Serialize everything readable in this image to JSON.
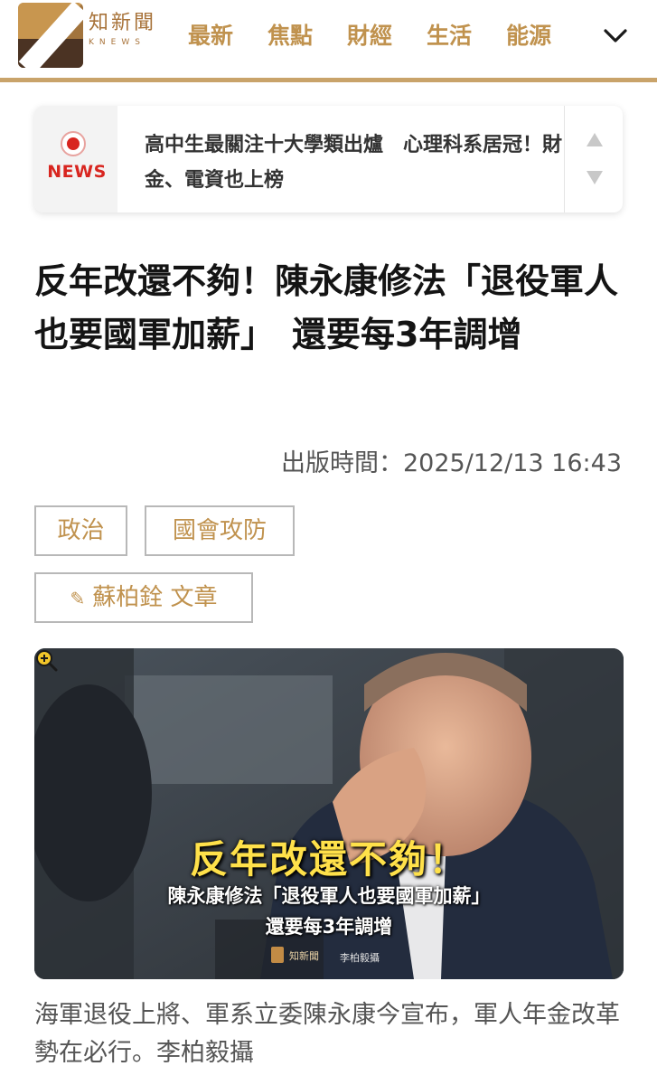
{
  "header": {
    "logo_cn": "知新聞",
    "logo_en": "KNEWS",
    "nav": [
      "最新",
      "焦點",
      "財經",
      "生活",
      "能源"
    ]
  },
  "ticker": {
    "badge": "NEWS",
    "headline": "高中生最關注十大學類出爐　心理科系居冠！財金、電資也上榜"
  },
  "article": {
    "title": "反年改還不夠！陳永康修法「退役軍人也要國軍加薪」　還要每3年調增",
    "published": "出版時間：2025/12/13 16:43",
    "tags": [
      "政治",
      "國會攻防"
    ],
    "author": "蘇柏銓 文章",
    "image": {
      "overlay_line1": "反年改還不夠！",
      "overlay_line2": "陳永康修法「退役軍人也要國軍加薪」",
      "overlay_line3": "還要每3年調增",
      "logo_text": "知新聞",
      "credit": "李柏毅攝"
    },
    "caption": "海軍退役上將、軍系立委陳永康今宣布，軍人年金改革勢在必行。李柏毅攝"
  },
  "colors": {
    "brand_gold": "#c0924e",
    "header_line": "#c9a36a",
    "news_red": "#d8251f",
    "overlay_yellow": "#ffe14a"
  },
  "icons": [
    "chevron-down-icon",
    "record-dot-icon",
    "arrow-up-icon",
    "arrow-down-icon",
    "pencil-icon",
    "zoom-in-icon"
  ]
}
